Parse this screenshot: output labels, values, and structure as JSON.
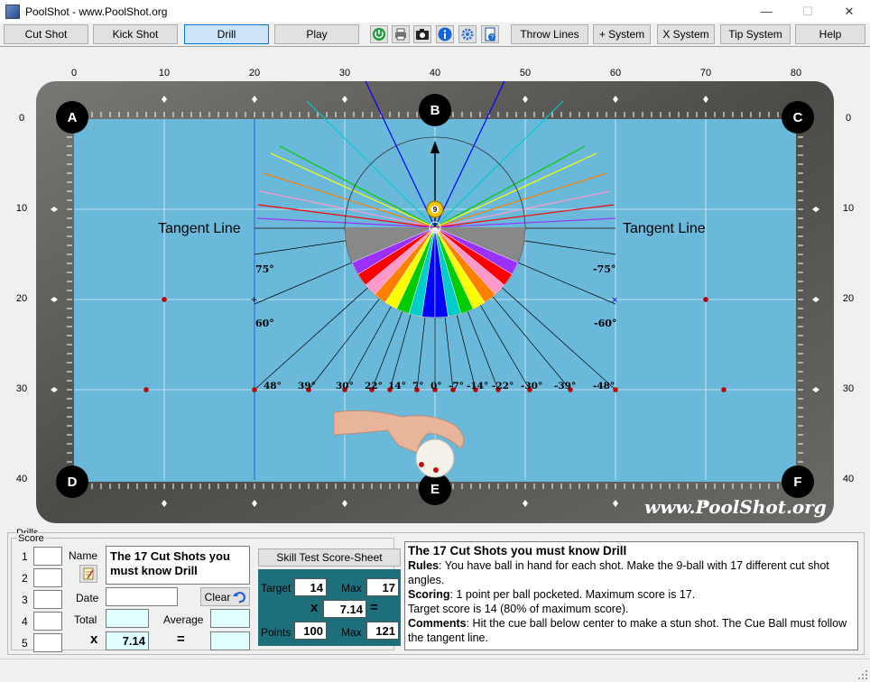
{
  "window": {
    "title": "PoolShot - www.PoolShot.org",
    "minimize": "—",
    "maximize": "☐",
    "close": "✕"
  },
  "toolbar": {
    "buttons": [
      {
        "label": "Cut Shot"
      },
      {
        "label": "Kick Shot"
      },
      {
        "label": "Drill",
        "active": true
      },
      {
        "label": "Play"
      },
      {
        "label": "Throw Lines"
      },
      {
        "label": "+ System"
      },
      {
        "label": "X System"
      },
      {
        "label": "Tip System"
      },
      {
        "label": "Help"
      }
    ],
    "icons": [
      "power-icon",
      "print-icon",
      "camera-icon",
      "info-icon",
      "settings-icon",
      "help-document-icon"
    ]
  },
  "table": {
    "x_ticks": [
      "0",
      "10",
      "20",
      "30",
      "40",
      "50",
      "60",
      "70",
      "80"
    ],
    "y_ticks": [
      "0",
      "10",
      "20",
      "30",
      "40"
    ],
    "pockets": [
      "A",
      "B",
      "C",
      "D",
      "E",
      "F"
    ],
    "watermark": "www.PoolShot.org",
    "tangent_left": "Tangent Line",
    "tangent_right": "Tangent Line",
    "object_ball": "9",
    "angle_labels_top": {
      "left75": "75°",
      "right75": "-75°",
      "left60": "60°",
      "right60": "-60°"
    },
    "angle_labels_row": [
      "48°",
      "39°",
      "30°",
      "22°",
      "14°",
      "7°",
      "0°",
      "-7°",
      "-14°",
      "-22°",
      "-30°",
      "-39°",
      "-48°"
    ],
    "colors": {
      "cloth": "#6ab8da",
      "rail": "#5d5b58",
      "fan": [
        "#9b30ff",
        "#ff0000",
        "#ff99cc",
        "#ff8000",
        "#ffff00",
        "#00cc00",
        "#00cccc",
        "#0000ff"
      ]
    }
  },
  "drills": {
    "group_label": "Drills",
    "score_label": "Score",
    "rows": [
      "1",
      "2",
      "3",
      "4",
      "5"
    ],
    "name_label": "Name",
    "name_value": "The 17 Cut Shots you must know Drill",
    "date_label": "Date",
    "date_value": "",
    "clear_label": "Clear",
    "total_label": "Total",
    "average_label": "Average",
    "x_label": "x",
    "multiplier": "7.14",
    "equals": "=",
    "skill_test_label": "Skill Test Score-Sheet",
    "target_label": "Target",
    "target_value": "14",
    "max_label": "Max",
    "max_value": "17",
    "score_x": "x",
    "score_multiplier": "7.14",
    "score_eq": "=",
    "points_label": "Points",
    "points_value": "100",
    "max2_label": "Max",
    "max2_value": "121"
  },
  "description": {
    "title": "The 17 Cut Shots you must know Drill",
    "rules_label": "Rules",
    "rules": ": You have ball in hand for each shot. Make the 9-ball with 17 different cut shot angles.",
    "scoring_label": "Scoring",
    "scoring": ": 1 point per ball pocketed. Maximum score is 17.",
    "target_line": "Target score is 14 (80% of maximum score).",
    "comments_label": "Comments",
    "comments": ": Hit the cue ball below center to make a stun shot. The Cue Ball must follow the tangent line."
  }
}
